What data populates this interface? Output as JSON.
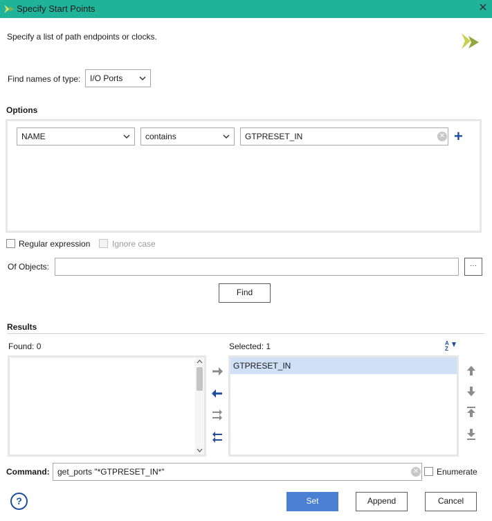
{
  "window": {
    "title": "Specify Start Points",
    "description": "Specify a list of path endpoints or clocks."
  },
  "find_type": {
    "label": "Find names of type:",
    "value": "I/O Ports"
  },
  "options": {
    "heading": "Options",
    "property_value": "NAME",
    "operator_value": "contains",
    "search_value": "GTPRESET_IN",
    "regular_expression_label": "Regular expression",
    "ignore_case_label": "Ignore case",
    "of_objects_label": "Of Objects:",
    "of_objects_value": "",
    "browse_label": "···"
  },
  "find_button": "Find",
  "results": {
    "heading": "Results",
    "found_label": "Found: 0",
    "selected_label": "Selected: 1",
    "found_items": [],
    "selected_items": [
      "GTPRESET_IN"
    ]
  },
  "command": {
    "label": "Command:",
    "value": "get_ports \"*GTPRESET_IN*\"",
    "enumerate_label": "Enumerate"
  },
  "footer": {
    "help": "?",
    "set": "Set",
    "append": "Append",
    "cancel": "Cancel"
  },
  "colors": {
    "titlebar": "#1fb49a",
    "accent_blue": "#1d4f9c",
    "primary_button": "#4a7fd1",
    "selection": "#cfe0f7"
  }
}
